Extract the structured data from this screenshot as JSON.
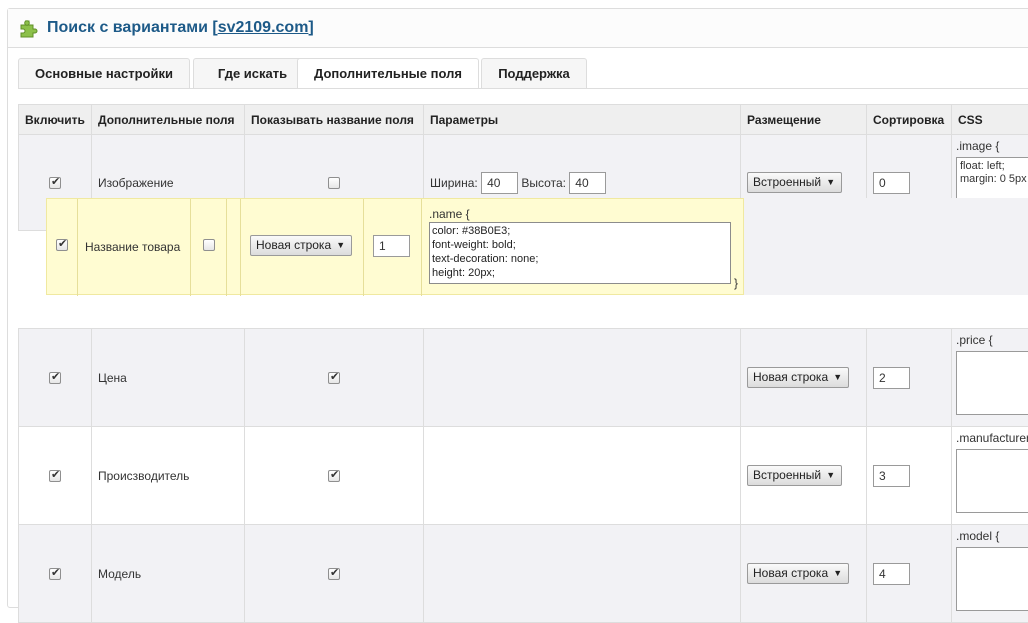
{
  "header": {
    "title": "Поиск с вариантами",
    "link": "sv2109.com",
    "bracket_open": "[",
    "bracket_close": "]"
  },
  "tabs": [
    {
      "label": "Основные настройки"
    },
    {
      "label": "Где искать"
    },
    {
      "label": "Дополнительные поля",
      "active": true
    },
    {
      "label": "Поддержка"
    }
  ],
  "table": {
    "headers": [
      "Включить",
      "Дополнительные поля",
      "Показывать название поля",
      "Параметры",
      "Размещение",
      "Сортировка",
      "CSS"
    ],
    "rows": [
      {
        "enabled": true,
        "field": "Изображение",
        "show_name": false,
        "params": {
          "width_label": "Ширина:",
          "width": "40",
          "height_label": "Высота:",
          "height": "40"
        },
        "placement": "Встроенный",
        "sort": "0",
        "css_label": ".image {",
        "css": "float: left;\nmargin: 0 5px"
      },
      {
        "enabled": true,
        "field": "Цена",
        "show_name": true,
        "placement": "Новая строка",
        "sort": "2",
        "css_label": ".price {",
        "css": ""
      },
      {
        "enabled": true,
        "field": "Происзводитель",
        "show_name": true,
        "placement": "Встроенный",
        "sort": "3",
        "css_label": ".manufacturer {",
        "css": ""
      },
      {
        "enabled": true,
        "field": "Модель",
        "show_name": true,
        "placement": "Новая строка",
        "sort": "4",
        "css_label": ".model {",
        "css": ""
      }
    ]
  },
  "dragging_row": {
    "enabled": true,
    "field": "Название товара",
    "show_name": false,
    "placement": "Новая строка",
    "sort": "1",
    "css_label": ".name {",
    "css": "color: #38B0E3;\nfont-weight: bold;\ntext-decoration: none;\nheight: 20px;",
    "brace": "}"
  },
  "colors": {
    "title": "#1d5a88",
    "drag_bg": "#fffcd2",
    "row_bg": "#f2f2f5"
  },
  "icons": {
    "header": "puzzle-icon",
    "select": "chevron-down-icon"
  }
}
